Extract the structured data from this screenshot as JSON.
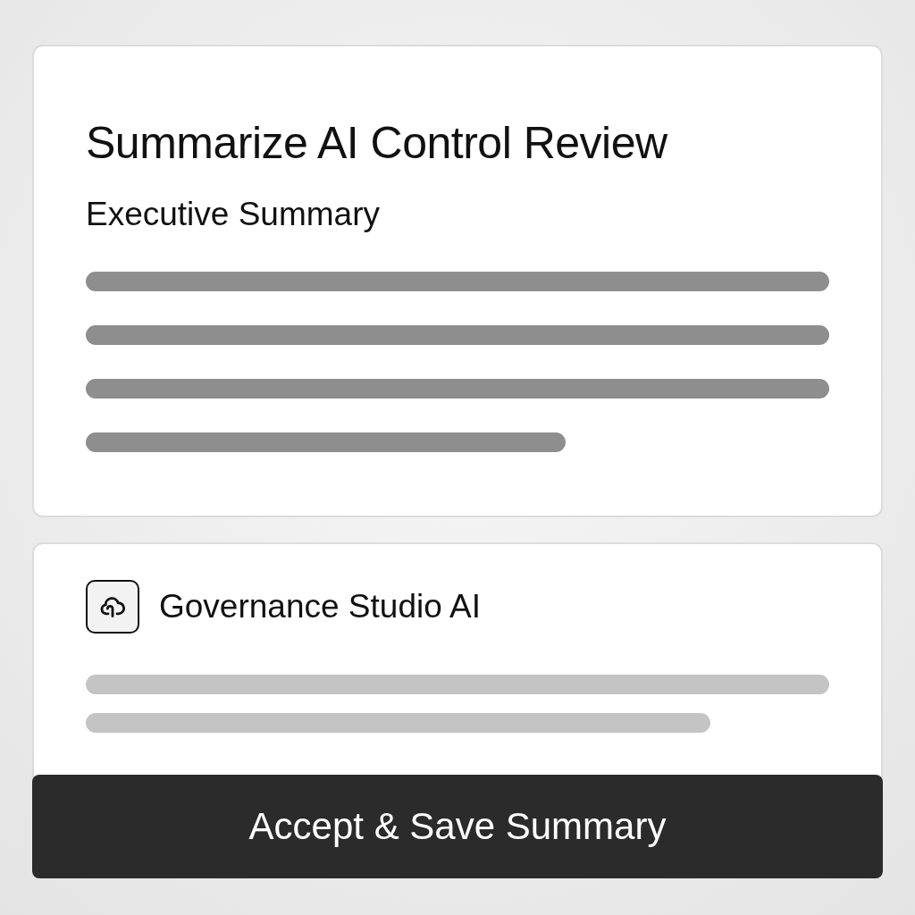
{
  "summary_card": {
    "title": "Summarize AI Control Review",
    "subtitle": "Executive Summary"
  },
  "assistant_card": {
    "name": "Governance Studio AI"
  },
  "action_button": {
    "label": "Accept & Save Summary"
  }
}
